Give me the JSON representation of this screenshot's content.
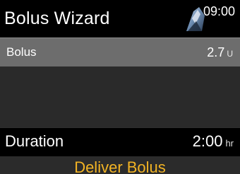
{
  "header": {
    "title": "Bolus Wizard",
    "time": "09:00",
    "status_icon": "reservoir-status-icon"
  },
  "rows": {
    "bolus": {
      "label": "Bolus",
      "value": "2.7",
      "unit": "U"
    },
    "duration": {
      "label": "Duration",
      "value": "2:00",
      "unit": "hr"
    },
    "deliver": {
      "label": "Deliver Bolus"
    }
  },
  "colors": {
    "background": "#000000",
    "highlight_row": "#6d6d6d",
    "dark_row": "#2a2a2a",
    "accent": "#f2b324",
    "text": "#ffffff"
  }
}
